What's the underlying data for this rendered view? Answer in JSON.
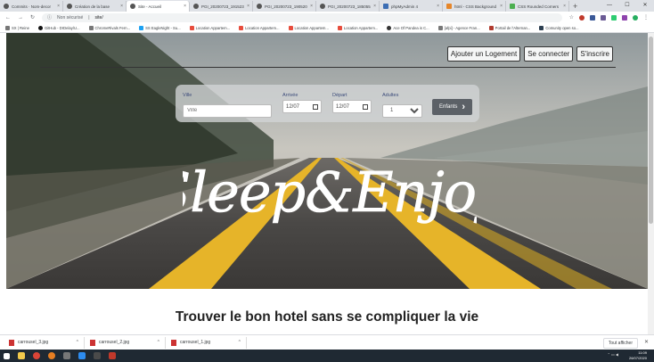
{
  "browser": {
    "tabs": [
      {
        "title": "Commits · Nom-decor",
        "active": false
      },
      {
        "title": "Création de la base",
        "active": false
      },
      {
        "title": "Site - Accueil",
        "active": true
      },
      {
        "title": "PGI_20200723_191523",
        "active": false
      },
      {
        "title": "PGI_20200723_190520",
        "active": false
      },
      {
        "title": "PGI_20200723_185055",
        "active": false
      },
      {
        "title": "phpMyAdmin 4",
        "active": false
      },
      {
        "title": "html - CSS Background",
        "active": false
      },
      {
        "title": "CSS Rounded Corners",
        "active": false
      }
    ],
    "new_tab": "+",
    "address": {
      "security": "Non sécurisé",
      "separator": "|",
      "url": "site/"
    },
    "bookmarks": [
      "SX | Reine",
      "GitHub - DrDelay/U...",
      "ChromeRivals Fern...",
      "SS EagleNight - Su...",
      "Location Appartem...",
      "Location Appartem...",
      "Location Appartem...",
      "Location Appartem...",
      "Ace Of Pandea is C...",
      "[afpi] - Agence Fran...",
      "Portail de l'Alternan...",
      "Comunity open so..."
    ]
  },
  "header": {
    "nav": [
      "Ajouter un Logement",
      "Se connecter",
      "S'inscrire"
    ]
  },
  "search": {
    "ville_label": "Ville",
    "ville_placeholder": "Ville",
    "arrivee_label": "Arrivée",
    "arrivee_value": "12/07",
    "depart_label": "Départ",
    "depart_value": "12/07",
    "adultes_label": "Adultes",
    "adultes_value": "1",
    "enfants_label": "Enfants"
  },
  "hero": {
    "logo_text": "Sleep&Enjoy"
  },
  "section": {
    "title": "Trouver le bon hotel sans se compliquer la vie"
  },
  "downloads": {
    "files": [
      "carrousel_3.jpg",
      "carrousel_2.jpg",
      "carrousel_1.jpg"
    ],
    "show_all": "Tout afficher"
  },
  "taskbar": {
    "time": "11:09",
    "date": "26/07/2020"
  }
}
